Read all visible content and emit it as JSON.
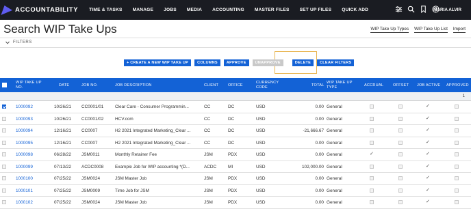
{
  "brand": {
    "logo_text": "ACCOUNTABILITY"
  },
  "nav": {
    "items": [
      "TIME & TASKS",
      "MANAGE",
      "JOBS",
      "MEDIA",
      "ACCOUNTING",
      "MASTER FILES",
      "SET UP FILES",
      "QUICK ADD"
    ],
    "user": "MARIA ALVIR"
  },
  "page": {
    "title": "Search WIP Take Ups",
    "links": [
      "WIP Take Up Types",
      "WIP Take Up List",
      "Import"
    ],
    "filters_label": "FILTERS"
  },
  "actions": {
    "create": "+ CREATE A NEW WIP TAKE UP",
    "columns": "COLUMNS",
    "approve": "APPROVE",
    "unapprove": "UNAPPROVE",
    "delete": "DELETE",
    "clear_filters": "CLEAR FILTERS"
  },
  "table": {
    "headers": {
      "wip": "WIP TAKE UP NO.",
      "date": "DATE",
      "job_no": "JOB NO.",
      "job_desc": "JOB DESCRIPTION",
      "client": "CLIENT",
      "office": "OFFICE",
      "currency": "CURRENCY CODE",
      "total": "TOTAL",
      "type": "WIP TAKE UP TYPE",
      "accrual": "ACCRUAL",
      "offset": "OFFSET",
      "job_active": "JOB ACTIVE",
      "approved": "APPROVED"
    },
    "subtotal": "1",
    "rows": [
      {
        "wip": "1000092",
        "date": "10/26/21",
        "job_no": "CC0001/01",
        "desc": "Clear Care - Consumer Programmin...",
        "client": "CC",
        "office": "DC",
        "currency": "USD",
        "total": "0.00",
        "type": "General",
        "selected": true,
        "accrual": false,
        "job_active": true
      },
      {
        "wip": "1000093",
        "date": "10/26/21",
        "job_no": "CC0001/02",
        "desc": "HCV.com",
        "client": "CC",
        "office": "DC",
        "currency": "USD",
        "total": "0.00",
        "type": "General",
        "selected": false,
        "accrual": false,
        "job_active": true
      },
      {
        "wip": "1000094",
        "date": "12/16/21",
        "job_no": "CC0007",
        "desc": "H2 2021 Integrated Marketing_Clear ...",
        "client": "CC",
        "office": "DC",
        "currency": "USD",
        "total": "-21,666.67",
        "type": "General",
        "selected": false,
        "accrual": false,
        "job_active": true
      },
      {
        "wip": "1000095",
        "date": "12/16/21",
        "job_no": "CC0007",
        "desc": "H2 2021 Integrated Marketing_Clear ...",
        "client": "CC",
        "office": "DC",
        "currency": "USD",
        "total": "0.00",
        "type": "General",
        "selected": false,
        "accrual": false,
        "job_active": true
      },
      {
        "wip": "1000098",
        "date": "06/28/22",
        "job_no": "JSM0011",
        "desc": "Monthly Retainer Fee",
        "client": "JSM",
        "office": "PDX",
        "currency": "USD",
        "total": "0.00",
        "type": "General",
        "selected": false,
        "accrual": true,
        "job_active": true
      },
      {
        "wip": "1000099",
        "date": "07/13/22",
        "job_no": "ACDC0008",
        "desc": "Example Job for WIP accounting *(D...",
        "client": "ACDC",
        "office": "MI",
        "currency": "USD",
        "total": "102,000.00",
        "type": "General",
        "selected": false,
        "accrual": false,
        "job_active": true
      },
      {
        "wip": "1000100",
        "date": "07/25/22",
        "job_no": "JSM0024",
        "desc": "JSM Master Job",
        "client": "JSM",
        "office": "PDX",
        "currency": "USD",
        "total": "0.00",
        "type": "General",
        "selected": false,
        "accrual": false,
        "job_active": true
      },
      {
        "wip": "1000101",
        "date": "07/25/22",
        "job_no": "JSM0009",
        "desc": "Time Job for JSM",
        "client": "JSM",
        "office": "PDX",
        "currency": "USD",
        "total": "0.00",
        "type": "General",
        "selected": false,
        "accrual": false,
        "job_active": true
      },
      {
        "wip": "1000102",
        "date": "07/25/22",
        "job_no": "JSM0024",
        "desc": "JSM Master Job",
        "client": "JSM",
        "office": "PDX",
        "currency": "USD",
        "total": "0.00",
        "type": "General",
        "selected": false,
        "accrual": false,
        "job_active": true
      }
    ]
  },
  "colors": {
    "accent": "#1362d6",
    "topbar": "#1a1c22",
    "logo": "#5f5cf0",
    "highlight": "#e8b24a"
  }
}
